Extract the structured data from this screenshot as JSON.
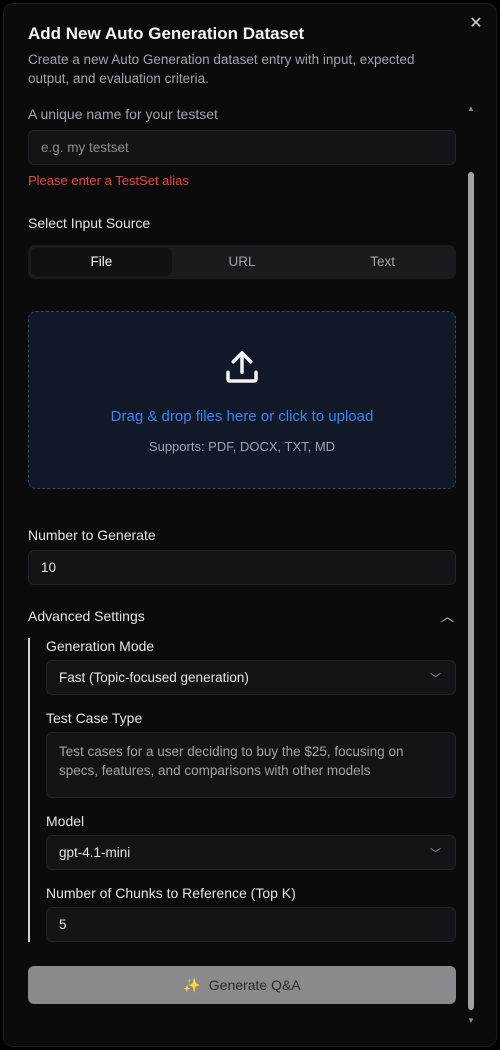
{
  "dialog": {
    "title": "Add New Auto Generation Dataset",
    "subtitle": "Create a new Auto Generation dataset entry with input, expected output, and evaluation criteria.",
    "close_icon": "close-icon"
  },
  "alias": {
    "label": "A unique name for your testset",
    "placeholder": "e.g. my testset",
    "value": "",
    "error": "Please enter a TestSet alias"
  },
  "input_source": {
    "label": "Select Input Source",
    "tabs": [
      "File",
      "URL",
      "Text"
    ],
    "active": "File"
  },
  "dropzone": {
    "icon": "upload-icon",
    "main_text": "Drag & drop files here or click to upload",
    "sub_text": "Supports: PDF, DOCX, TXT, MD"
  },
  "number_to_generate": {
    "label": "Number to Generate",
    "value": "10"
  },
  "advanced": {
    "label": "Advanced Settings",
    "expanded": true,
    "generation_mode": {
      "label": "Generation Mode",
      "value": "Fast (Topic-focused generation)"
    },
    "test_case_type": {
      "label": "Test Case Type",
      "placeholder": "Test cases for a user deciding to buy the $25, focusing on specs, features, and comparisons with other models"
    },
    "model": {
      "label": "Model",
      "value": "gpt-4.1-mini"
    },
    "top_k": {
      "label": "Number of Chunks to Reference (Top K)",
      "value": "5"
    }
  },
  "generate_button": {
    "label": "Generate Q&A",
    "icon": "sparkle-icon"
  },
  "colors": {
    "background": "#0b0b0c",
    "error": "#ef4444",
    "link_blue": "#3b82f6",
    "dropzone_bg": "#111827",
    "button_disabled": "#8a8a8c",
    "sparkle": "#c98a2e"
  }
}
